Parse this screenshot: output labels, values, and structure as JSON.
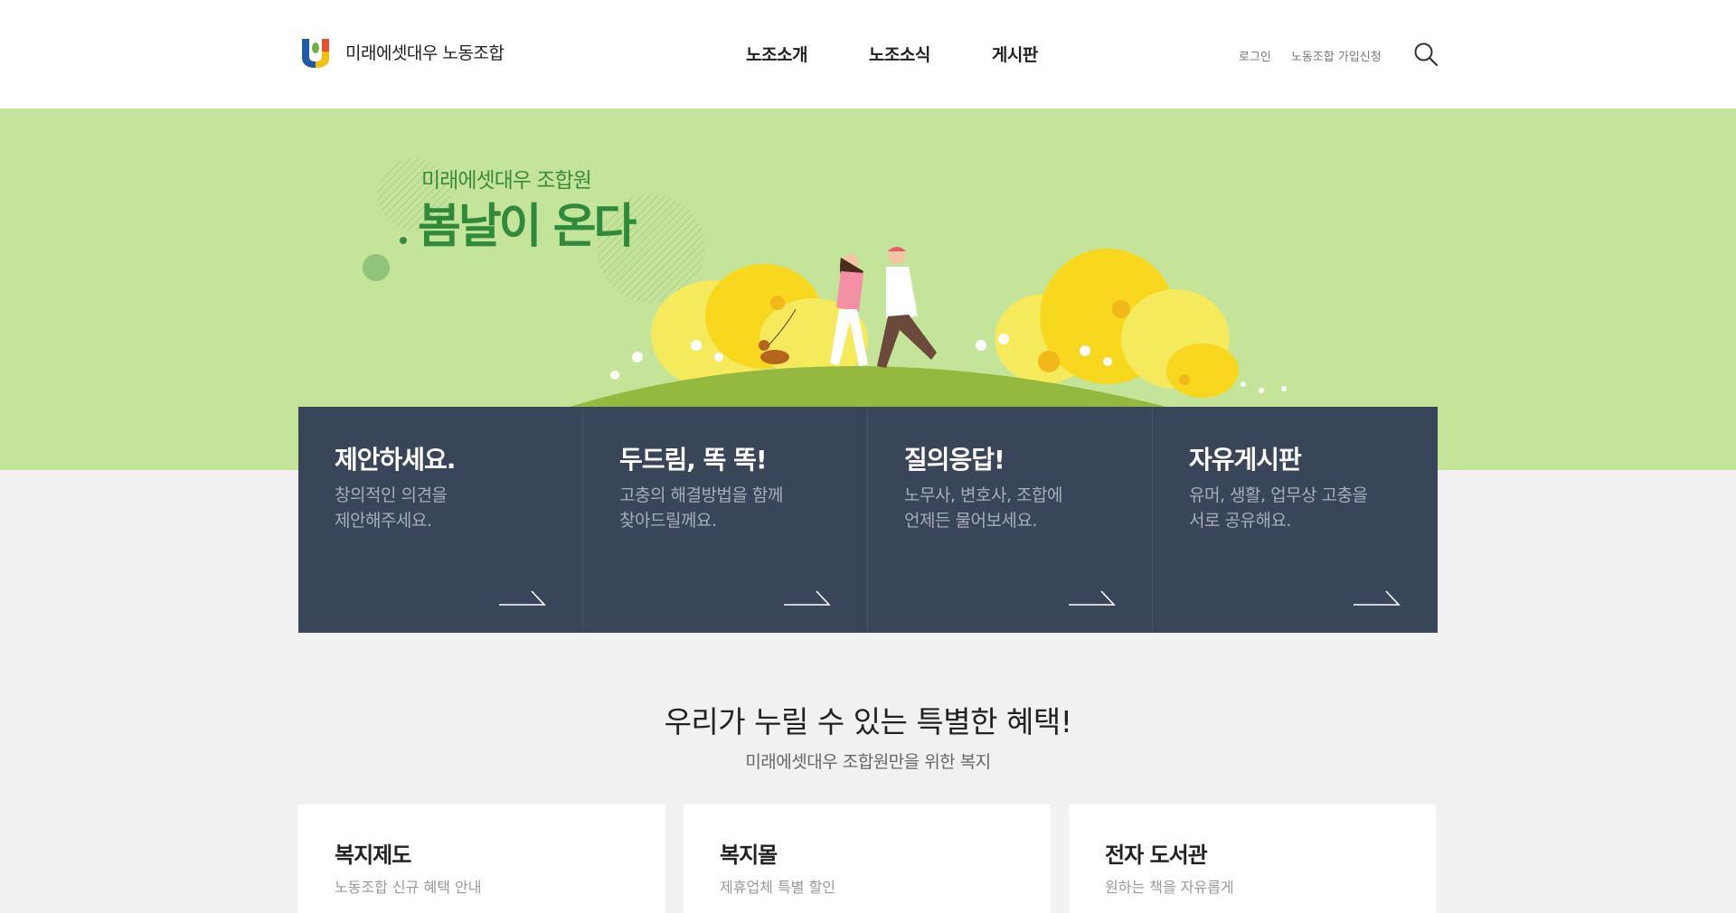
{
  "header": {
    "logo_text": "미래에셋대우 노동조합",
    "nav": [
      "노조소개",
      "노조소식",
      "게시판"
    ],
    "util": [
      "로그인",
      "노동조합 가입신청"
    ]
  },
  "hero": {
    "subtitle": "미래에셋대우 조합원",
    "title": "봄날이 온다"
  },
  "cards": [
    {
      "title": "제안하세요.",
      "desc_line1": "창의적인 의견을",
      "desc_line2": "제안해주세요."
    },
    {
      "title": "두드림, 똑 똑!",
      "desc_line1": "고충의 해결방법을 함께",
      "desc_line2": "찾아드릴께요."
    },
    {
      "title": "질의응답!",
      "desc_line1": "노무사, 변호사, 조합에",
      "desc_line2": "언제든 물어보세요."
    },
    {
      "title": "자유게시판",
      "desc_line1": "유머, 생활, 업무상 고충을",
      "desc_line2": "서로 공유해요."
    }
  ],
  "benefits": {
    "title": "우리가 누릴 수 있는 특별한 혜택!",
    "subtitle": "미래에셋대우 조합원만을 위한 복지",
    "items": [
      {
        "title": "복지제도",
        "desc": "노동조합 신규 혜택 안내"
      },
      {
        "title": "복지몰",
        "desc": "제휴업체 특별 할인"
      },
      {
        "title": "전자 도서관",
        "desc": "원하는 책을 자유롭게"
      }
    ]
  },
  "colors": {
    "hero_bg": "#c4e49a",
    "card_bg": "#394558",
    "accent_green": "#2f8a3b"
  }
}
